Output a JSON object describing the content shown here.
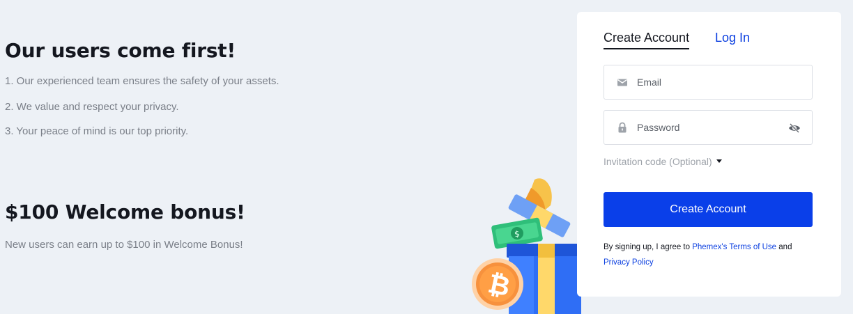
{
  "left": {
    "headline": "Our users come first!",
    "points": [
      "1. Our experienced team ensures the safety of your assets.",
      "2. We value and respect your privacy.",
      "3. Your peace of mind is our top priority."
    ],
    "bonus_title": "$100 Welcome bonus!",
    "bonus_desc": "New users can earn up to $100 in Welcome Bonus!"
  },
  "card": {
    "tabs": {
      "create": "Create Account",
      "login": "Log In"
    },
    "email": {
      "placeholder": "Email",
      "value": "",
      "icon": "envelope-icon"
    },
    "password": {
      "placeholder": "Password",
      "value": "",
      "icon": "lock-icon",
      "toggle_icon": "eye-slash-icon"
    },
    "invitation_label": "Invitation code (Optional)",
    "submit_label": "Create Account",
    "terms": {
      "prefix": "By signing up, I agree to ",
      "terms_link": "Phemex's Terms of Use",
      "middle": " and",
      "privacy_link": "Privacy Policy"
    }
  },
  "colors": {
    "background": "#edf1f6",
    "accent": "#0a3fe9",
    "link": "#0b3fe0",
    "text": "#14171f",
    "muted": "#7a7f88"
  }
}
